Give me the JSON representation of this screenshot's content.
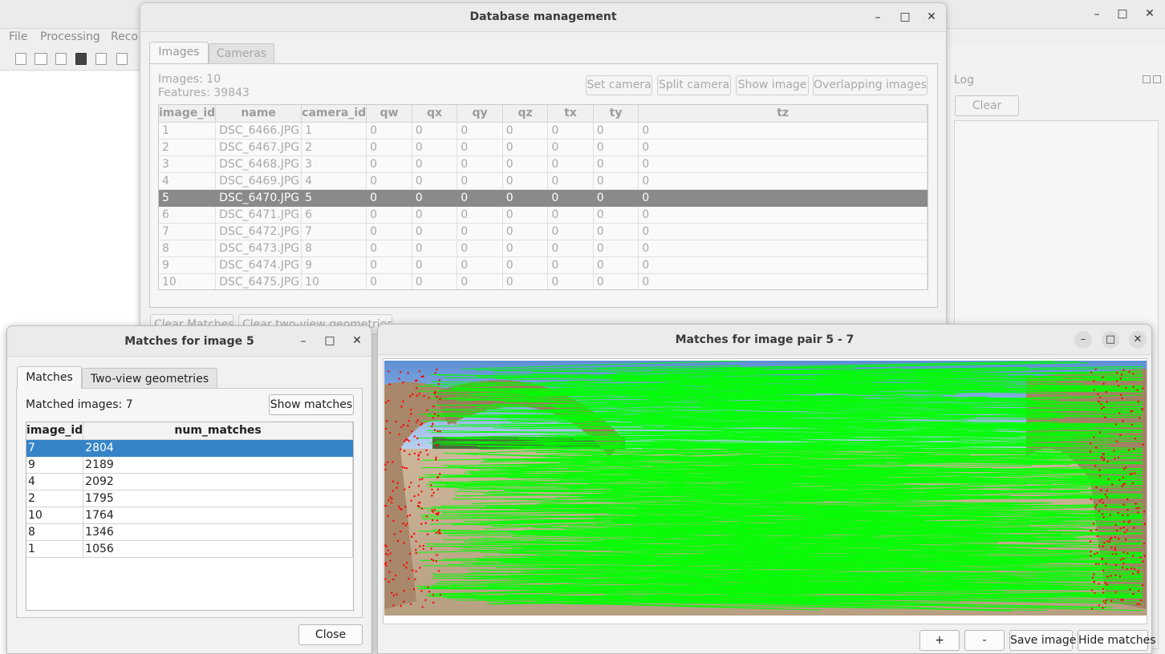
{
  "main": {
    "menu": [
      "File",
      "Processing",
      "Reco"
    ],
    "log": {
      "title": "Log",
      "clear_label": "Clear"
    }
  },
  "db": {
    "title": "Database management",
    "tabs": [
      "Images",
      "Cameras"
    ],
    "images_count": "Images: 10",
    "features_count": "Features: 39843",
    "buttons": [
      "Set camera",
      "Split camera",
      "Show image",
      "Overlapping images"
    ],
    "columns": [
      "image_id",
      "name",
      "camera_id",
      "qw",
      "qx",
      "qy",
      "qz",
      "tx",
      "ty",
      "tz"
    ],
    "rows": [
      [
        "1",
        "DSC_6466.JPG",
        "1",
        "0",
        "0",
        "0",
        "0",
        "0",
        "0",
        "0"
      ],
      [
        "2",
        "DSC_6467.JPG",
        "2",
        "0",
        "0",
        "0",
        "0",
        "0",
        "0",
        "0"
      ],
      [
        "3",
        "DSC_6468.JPG",
        "3",
        "0",
        "0",
        "0",
        "0",
        "0",
        "0",
        "0"
      ],
      [
        "4",
        "DSC_6469.JPG",
        "4",
        "0",
        "0",
        "0",
        "0",
        "0",
        "0",
        "0"
      ],
      [
        "5",
        "DSC_6470.JPG",
        "5",
        "0",
        "0",
        "0",
        "0",
        "0",
        "0",
        "0"
      ],
      [
        "6",
        "DSC_6471.JPG",
        "6",
        "0",
        "0",
        "0",
        "0",
        "0",
        "0",
        "0"
      ],
      [
        "7",
        "DSC_6472.JPG",
        "7",
        "0",
        "0",
        "0",
        "0",
        "0",
        "0",
        "0"
      ],
      [
        "8",
        "DSC_6473.JPG",
        "8",
        "0",
        "0",
        "0",
        "0",
        "0",
        "0",
        "0"
      ],
      [
        "9",
        "DSC_6474.JPG",
        "9",
        "0",
        "0",
        "0",
        "0",
        "0",
        "0",
        "0"
      ],
      [
        "10",
        "DSC_6475.JPG",
        "10",
        "0",
        "0",
        "0",
        "0",
        "0",
        "0",
        "0"
      ]
    ],
    "selected_row_index": 4,
    "bottom_buttons": [
      "Clear Matches",
      "Clear two-view geometries"
    ]
  },
  "matches_window": {
    "title": "Matches for image 5",
    "tabs": [
      "Matches",
      "Two-view geometries"
    ],
    "matched_images": "Matched images: 7",
    "show_matches_label": "Show matches",
    "columns": [
      "image_id",
      "num_matches"
    ],
    "rows": [
      [
        "7",
        "2804"
      ],
      [
        "9",
        "2189"
      ],
      [
        "4",
        "2092"
      ],
      [
        "2",
        "1795"
      ],
      [
        "10",
        "1764"
      ],
      [
        "8",
        "1346"
      ],
      [
        "1",
        "1056"
      ]
    ],
    "selected_row_index": 0,
    "close_label": "Close"
  },
  "pair_window": {
    "title": "Matches for image pair 5 - 7",
    "buttons": [
      "+",
      "-",
      "Save image",
      "Hide matches"
    ]
  },
  "colors": {
    "match_line": "#00ff00",
    "keypoint": "#ff0000",
    "selection_blue": "#3584c7",
    "selection_gray": "#8a8a8a"
  }
}
